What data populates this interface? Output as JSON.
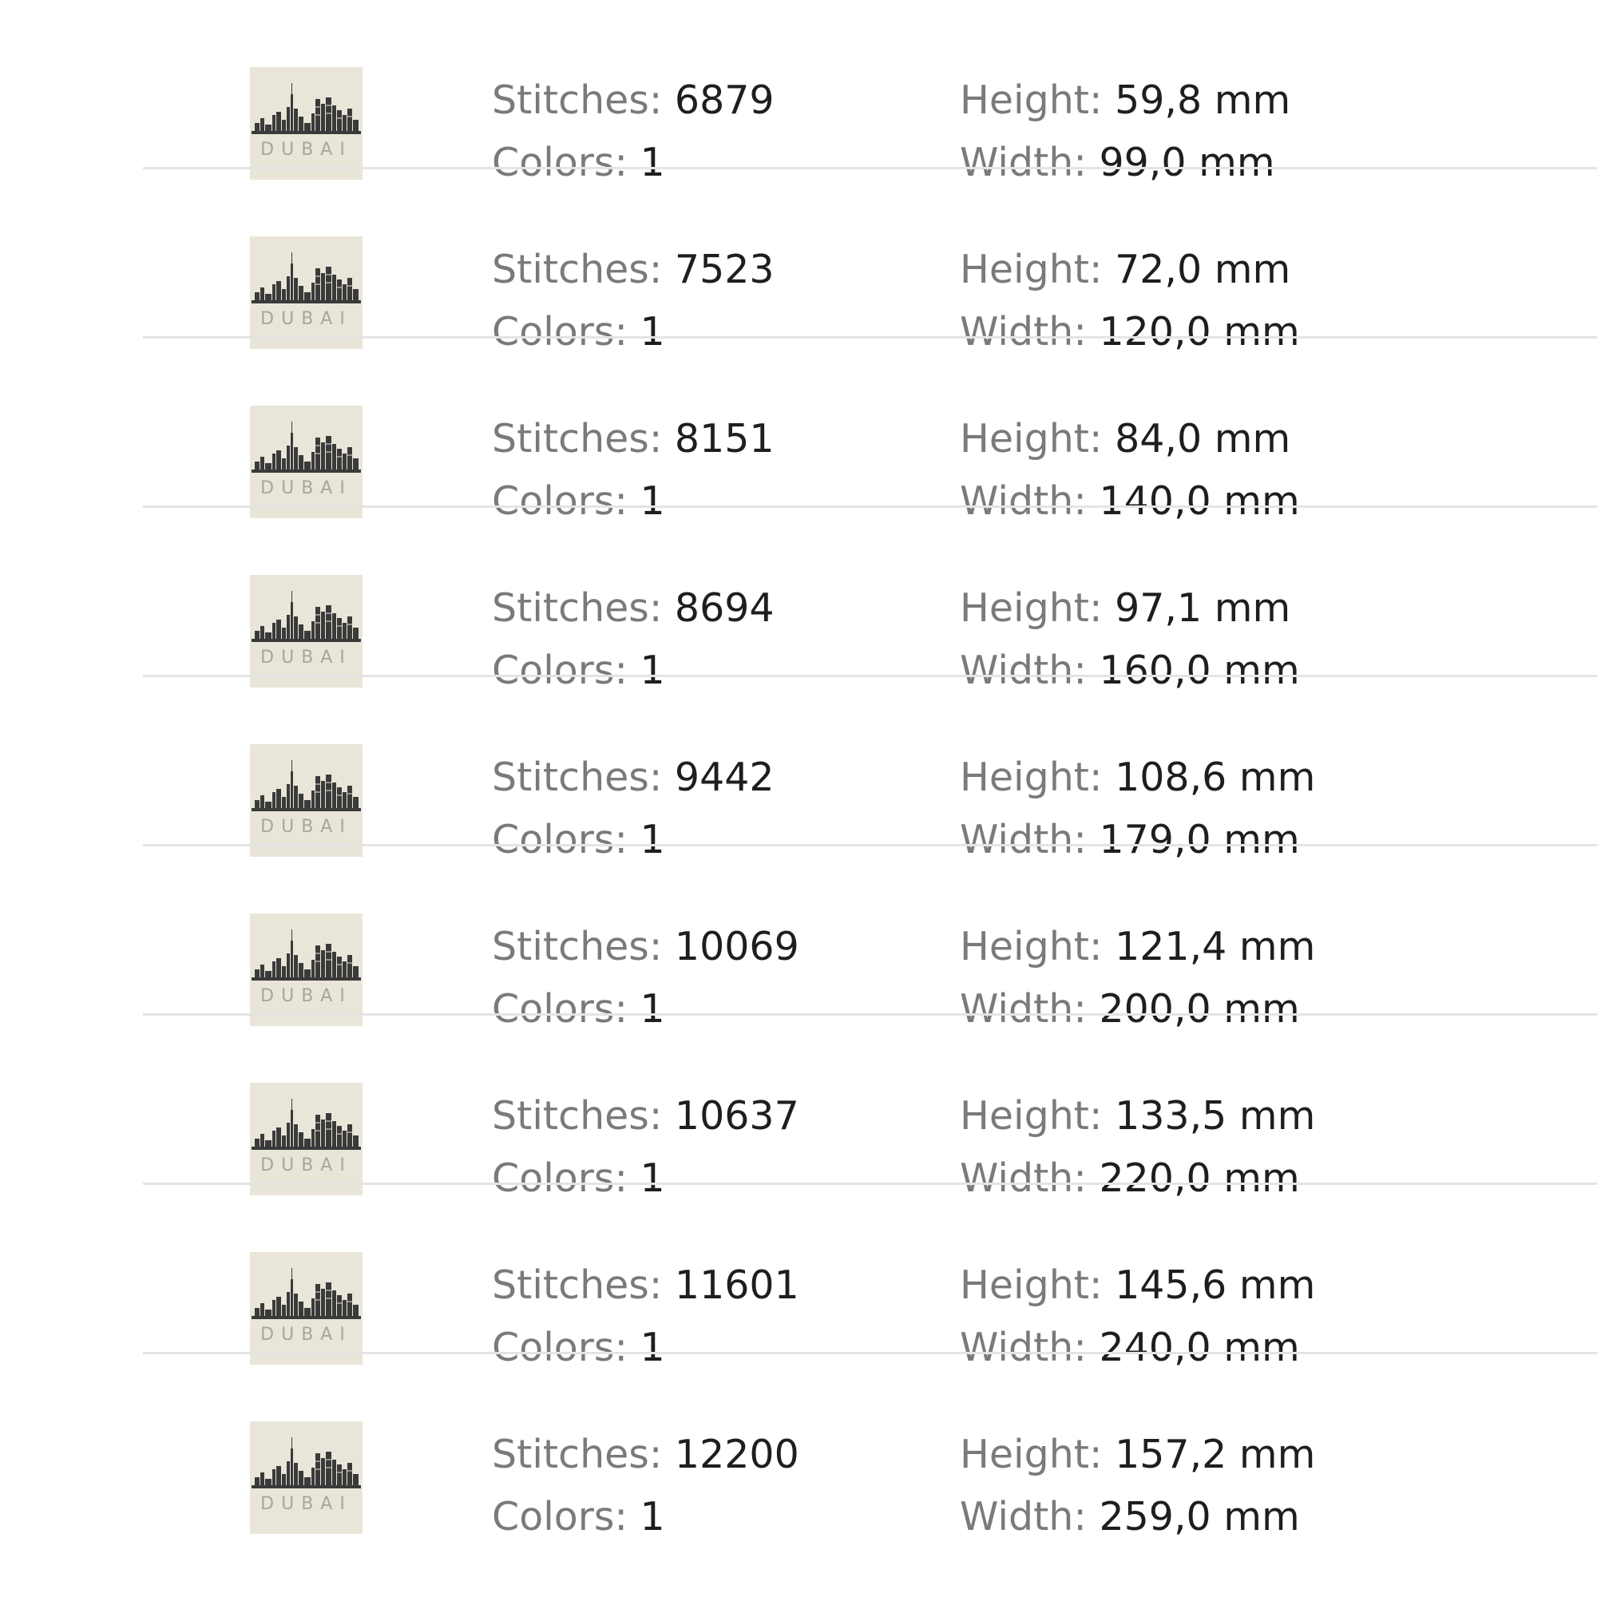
{
  "labels": {
    "stitches": "Stitches:",
    "colors": "Colors:",
    "height": "Height:",
    "width": "Width:"
  },
  "thumbnail": {
    "icon": "dubai-skyline-thumbnail-icon",
    "text": "DUBAI",
    "background": "#e9e5d8"
  },
  "items": [
    {
      "stitches": "6879",
      "colors": "1",
      "height": "59,8 mm",
      "width": "99,0 mm"
    },
    {
      "stitches": "7523",
      "colors": "1",
      "height": "72,0 mm",
      "width": "120,0 mm"
    },
    {
      "stitches": "8151",
      "colors": "1",
      "height": "84,0 mm",
      "width": "140,0 mm"
    },
    {
      "stitches": "8694",
      "colors": "1",
      "height": "97,1 mm",
      "width": "160,0 mm"
    },
    {
      "stitches": "9442",
      "colors": "1",
      "height": "108,6 mm",
      "width": "179,0 mm"
    },
    {
      "stitches": "10069",
      "colors": "1",
      "height": "121,4 mm",
      "width": "200,0 mm"
    },
    {
      "stitches": "10637",
      "colors": "1",
      "height": "133,5 mm",
      "width": "220,0 mm"
    },
    {
      "stitches": "11601",
      "colors": "1",
      "height": "145,6 mm",
      "width": "240,0 mm"
    },
    {
      "stitches": "12200",
      "colors": "1",
      "height": "157,2 mm",
      "width": "259,0 mm"
    }
  ]
}
